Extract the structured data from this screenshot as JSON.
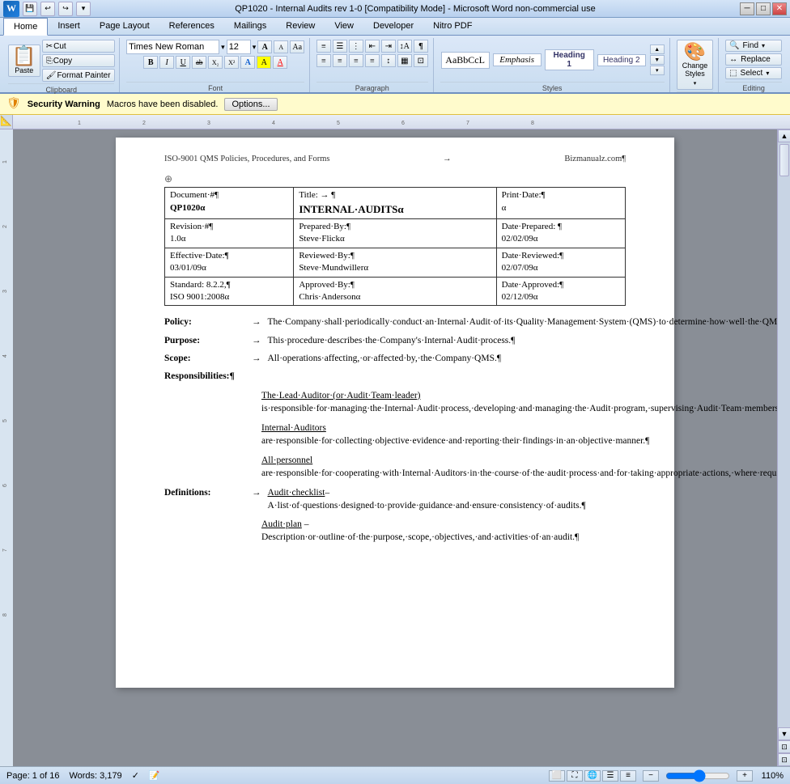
{
  "titlebar": {
    "title": "QP1020 - Internal Audits rev 1-0 [Compatibility Mode] - Microsoft Word non-commercial use",
    "minimize": "─",
    "maximize": "□",
    "close": "✕"
  },
  "quickaccess": {
    "icons": [
      "💾",
      "↩",
      "↪",
      "🔄"
    ]
  },
  "tabs": {
    "items": [
      "Home",
      "Insert",
      "Page Layout",
      "References",
      "Mailings",
      "Review",
      "View",
      "Developer",
      "Nitro PDF"
    ]
  },
  "ribbon": {
    "clipboard": {
      "label": "Clipboard",
      "paste": "Paste",
      "cut": "Cut",
      "copy": "Copy",
      "format_painter": "Format Painter"
    },
    "font": {
      "label": "Font",
      "name": "Times New Roman",
      "size": "12",
      "grow": "A",
      "shrink": "A",
      "clear": "Aa",
      "bold": "B",
      "italic": "I",
      "underline": "U",
      "strikethrough": "ab",
      "subscript": "X₂",
      "superscript": "X²",
      "text_effects": "A",
      "highlight": "A",
      "color": "A"
    },
    "paragraph": {
      "label": "Paragraph",
      "bullets": "≡",
      "numbering": "≡",
      "indent_decrease": "←",
      "indent_increase": "→",
      "sort": "↕",
      "show_marks": "¶",
      "align_left": "≡",
      "align_center": "≡",
      "align_right": "≡",
      "justify": "≡",
      "line_spacing": "↕",
      "shading": "▦",
      "borders": "⊟"
    },
    "styles": {
      "label": "Styles",
      "emphasis": "Emphasis",
      "heading1": "Heading 1",
      "heading2": "Heading 2",
      "normal": "AaBbCcL",
      "scroll_up": "▲",
      "scroll_down": "▼",
      "more": "▼"
    },
    "change_styles": {
      "label": "Change\nStyles",
      "icon": "🎨"
    },
    "editing": {
      "label": "Editing",
      "find": "Find",
      "replace": "Replace",
      "select": "Select"
    }
  },
  "security": {
    "warning_label": "Security Warning",
    "message": "Macros have been disabled.",
    "options_btn": "Options..."
  },
  "document": {
    "header_left": "ISO-9001 QMS Policies, Procedures, and Forms",
    "header_arrow": "→",
    "header_right": "Bizmanualz.com¶",
    "table": {
      "rows": [
        {
          "col1_label": "Document #¶",
          "col1_value": "QP1020α",
          "col2_label": "Title: →  ¶",
          "col2_value": "INTERNAL·AUDITSα",
          "col3_label": "Print·Date:¶",
          "col3_value": "α"
        },
        {
          "col1_label": "Revision #¶",
          "col1_value": "1.0α",
          "col2_label": "Prepared·By:¶",
          "col2_value": "Steve·Flickα",
          "col3_label": "Date·Prepared: ¶",
          "col3_value": "02/02/09α"
        },
        {
          "col1_label": "Effective·Date:¶",
          "col1_value": "03/01/09α",
          "col2_label": "Reviewed·By:¶",
          "col2_value": "Steve·Mundwillerα",
          "col3_label": "Date·Reviewed:¶",
          "col3_value": "02/07/09α"
        },
        {
          "col1_label": "Standard: 8.2.2,¶",
          "col1_value": "ISO 9001:2008α",
          "col2_label": "Approved·By:¶",
          "col2_value": "Chris·Andersonα",
          "col3_label": "Date·Approved:¶",
          "col3_value": "02/12/09α"
        }
      ]
    },
    "policy": {
      "label": "Policy:",
      "text": "The·Company·shall·periodically·conduct·an·Internal·Audit·of·its·Quality·Management·System·(QMS)·to·determine·how·well·the·QMS·conforms·to·planned·arrangements·and·applicable·requirements and to·determine·if·it·is·being·effectively·implemented,·maintained,·and·improved·where·possible.¶"
    },
    "purpose": {
      "label": "Purpose:",
      "text": "This·procedure·describes·the·Company's·Internal·Audit·process.¶"
    },
    "scope": {
      "label": "Scope:",
      "text": "All·operations·affecting,·or·affected·by,·the·Company·QMS.¶"
    },
    "responsibilities": {
      "label": "Responsibilities:¶",
      "items": [
        {
          "link": "The Lead·Auditor·(or·Audit·Team·leader)",
          "text": " is·responsible·for·managing·the·Internal·Audit·process,·developing·and·managing·the·Audit·program,·supervising·Audit·Team·members,·and·reporting·the·Audit·Team's·findings·to·top·management.¶"
        },
        {
          "link": "Internal·Auditors",
          "text": " are·responsible·for·collecting·objective·evidence·and·reporting·their·findings·in·an·objective·manner.¶"
        },
        {
          "link": "All personnel",
          "text": " are·responsible·for·cooperating·with·Internal·Auditors·in·the·course·of·the·audit·process·and·for·taking·appropriate·actions,·where·required,·to·correct·nonconformities·found·during·the·audit.¶"
        }
      ]
    },
    "definitions": {
      "label": "Definitions:",
      "items": [
        {
          "link": "Audit checklist",
          "text": "–A·list·of·questions·designed·to·provide·guidance·and·ensure·consistency·of·audits.¶"
        },
        {
          "link": "Audit plan",
          "text": " –Description·or·outline·of·the·purpose,·scope,·objectives,·and·activities·of·an·audit.¶"
        }
      ]
    }
  },
  "statusbar": {
    "page_info": "Page: 1 of 16",
    "words": "Words: 3,179",
    "zoom": "110%",
    "zoom_minus": "−",
    "zoom_plus": "+"
  }
}
